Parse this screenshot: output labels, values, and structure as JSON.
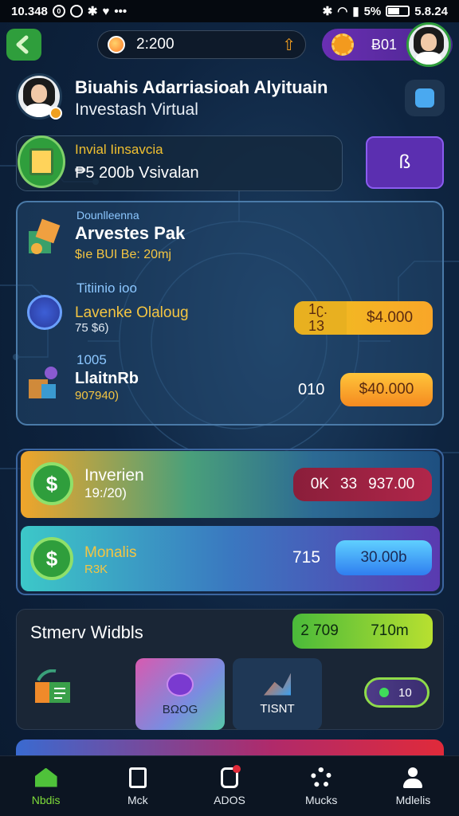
{
  "status_bar": {
    "time": "10.348",
    "battery_text": "5%",
    "right_time": "5.8.24"
  },
  "top_bar": {
    "coin_value": "2:200",
    "gear_value": "Ƀ01"
  },
  "profile": {
    "name": "Biuahis Adarriasioah Alyituain",
    "subtitle": "Investash Virtual"
  },
  "investment": {
    "title": "Invial Iinsavcia",
    "value": "₱5 200b Vsivalan",
    "button_label": "ß"
  },
  "offers": {
    "item1": {
      "label": "Dounlleenna",
      "title": "Arvestes Pak",
      "subtitle": "$ıe BUI Be: 20mj"
    },
    "item2": {
      "label": "Titiinio ioo",
      "title": "Lavenke Olaloug",
      "subtitle": "75 $6)",
      "pill_left": "1ʗ. 13",
      "pill_right": "$4.000"
    },
    "item3": {
      "label": "1005",
      "title": "LlaitnRb",
      "subtitle": "907940)",
      "count": "010",
      "pill": "$40.000"
    }
  },
  "rewards": {
    "row1": {
      "icon_glyph": "$",
      "title": "Inverien",
      "subtitle": "19:/20)",
      "pill_left": "0K",
      "pill_mid": "33",
      "pill_right": "937.00"
    },
    "row2": {
      "icon_glyph": "$",
      "title": "Monalis",
      "subtitle": "R3K",
      "count": "715",
      "pill": "30.00b"
    }
  },
  "games": {
    "title": "Stmerv Widbls",
    "pill_left": "2 709",
    "pill_right": "710m",
    "card1_label": "BΩOG",
    "card2_label": "TISNT",
    "ticket_text": "10"
  },
  "nav": [
    {
      "label": "Nbdis",
      "icon": "home-icon"
    },
    {
      "label": "Mck",
      "icon": "shop-icon"
    },
    {
      "label": "ADOS",
      "icon": "bag-icon"
    },
    {
      "label": "Mucks",
      "icon": "gear-icon"
    },
    {
      "label": "Mdlelis",
      "icon": "person-icon"
    }
  ],
  "colors": {
    "accent_green": "#2f9e3c",
    "accent_purple": "#5b2fb0",
    "accent_yellow": "#f4c542",
    "background": "#0e2440"
  }
}
